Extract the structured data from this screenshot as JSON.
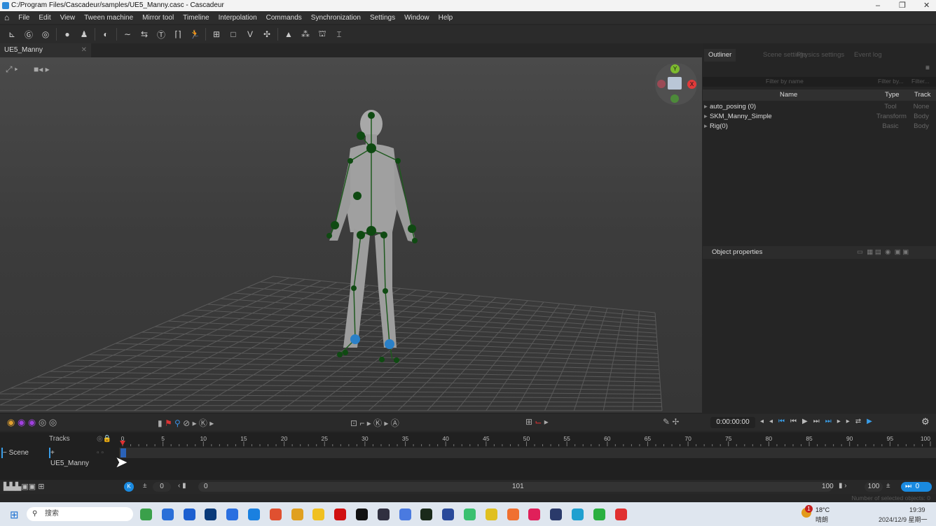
{
  "window": {
    "title": "C:/Program Files/Cascadeur/samples/UE5_Manny.casc - Cascadeur",
    "min": "–",
    "max": "❐",
    "close": "✕"
  },
  "menu": [
    "File",
    "Edit",
    "View",
    "Tween machine",
    "Mirror tool",
    "Timeline",
    "Interpolation",
    "Commands",
    "Synchronization",
    "Settings",
    "Window",
    "Help"
  ],
  "doc_tab": {
    "label": "UE5_Manny",
    "close": "✕"
  },
  "gizmo": {
    "y": "Y",
    "x": "X"
  },
  "outliner": {
    "tabs": [
      "Outliner",
      "Scene settings",
      "Physics settings",
      "Event log"
    ],
    "filters": {
      "name": "Filter by name",
      "type": "Filter by...",
      "track": "Filter..."
    },
    "columns": [
      "Name",
      "Type",
      "Track"
    ],
    "rows": [
      {
        "name": "auto_posing (0)",
        "type": "Tool",
        "track": "None"
      },
      {
        "name": "SKM_Manny_Simple",
        "type": "Transform",
        "track": "Body"
      },
      {
        "name": "Rig(0)",
        "type": "Basic",
        "track": "Body"
      }
    ]
  },
  "object_properties": {
    "title": "Object properties"
  },
  "timeline": {
    "time": "0:00:00:00",
    "tracks_label": "Tracks",
    "scene_label": "− Scene",
    "track_name": "+ UE5_Manny",
    "ruler": {
      "min": 0,
      "max": 100,
      "step": 5
    },
    "current_frame": 0,
    "start": "0",
    "range_start": "0",
    "range_mid": "101",
    "range_end": "100",
    "end": "100",
    "current": "0"
  },
  "status": {
    "selected": "Number of selected objects: 0"
  },
  "taskbar": {
    "search": "搜索",
    "weather_temp": "18°C",
    "weather_desc": "晴朗",
    "badge": "1",
    "time": "19:39",
    "date": "2024/12/9 星期一"
  }
}
